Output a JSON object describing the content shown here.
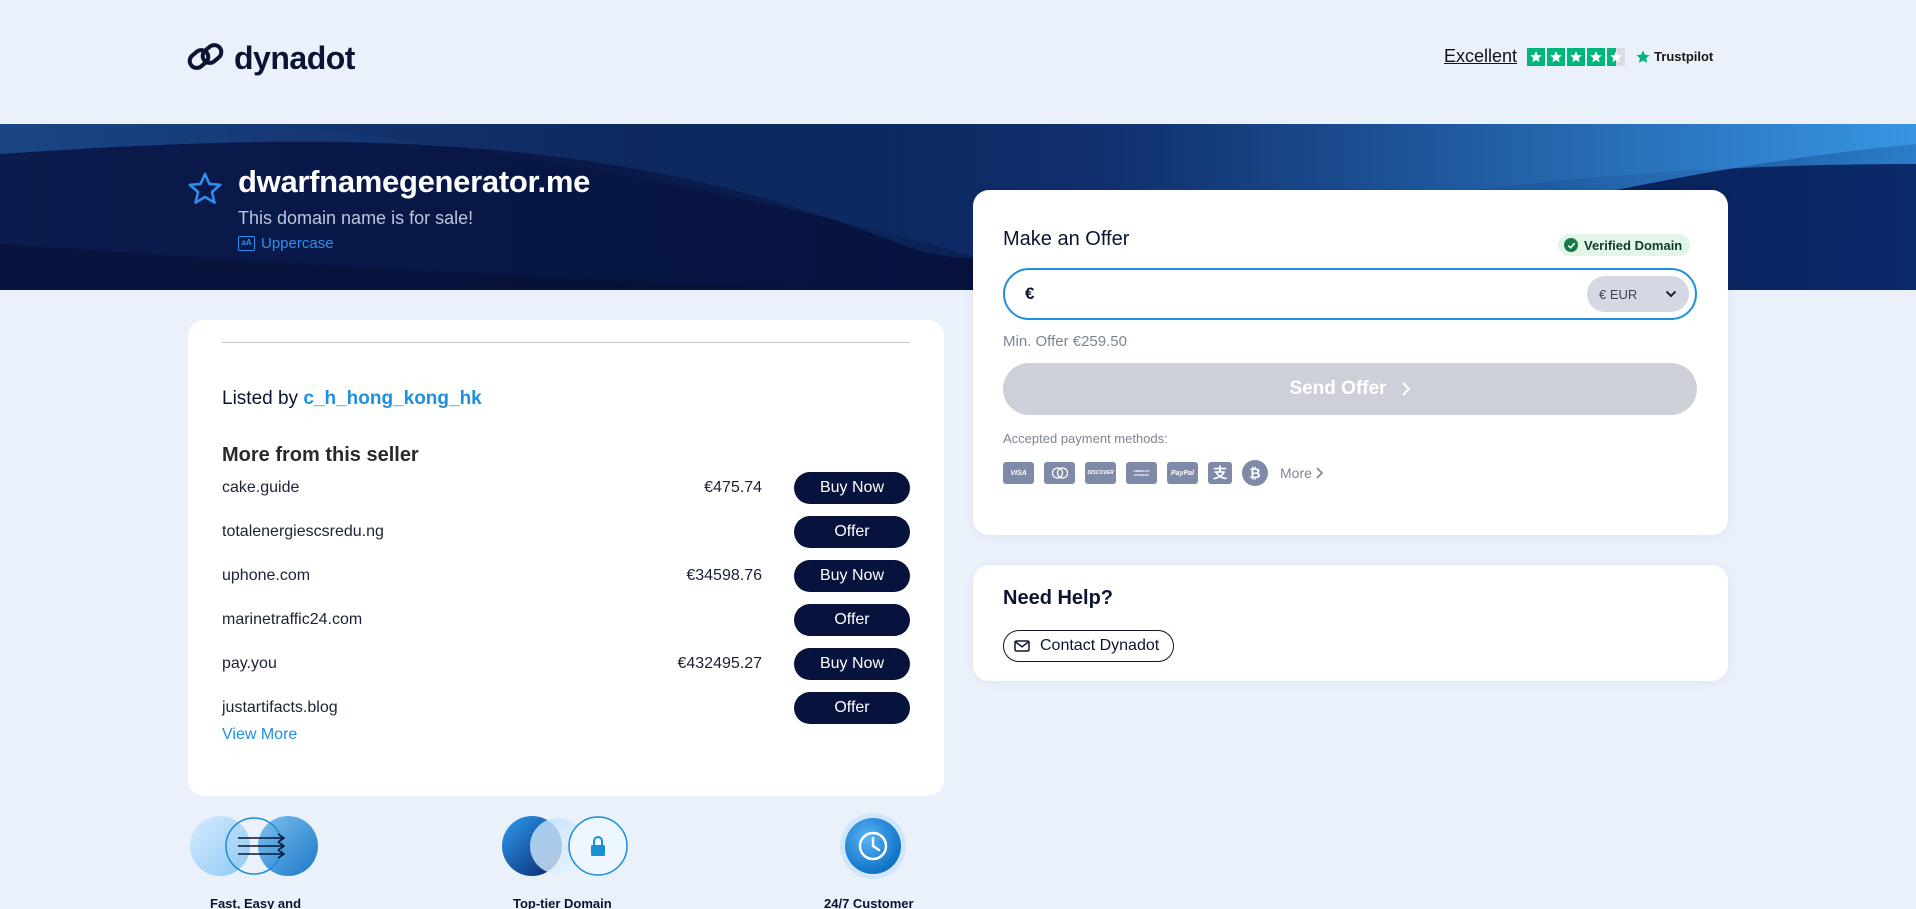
{
  "brand": {
    "name": "dynadot"
  },
  "trustpilot": {
    "rating_label": "Excellent",
    "brand": "Trustpilot",
    "stars": 4.5
  },
  "domain": {
    "name": "dwarfnamegenerator.me",
    "subtitle": "This domain name is for sale!",
    "uppercase_label": "Uppercase"
  },
  "seller": {
    "listed_prefix": "Listed by ",
    "username": "c_h_hong_kong_hk",
    "more_heading": "More from this seller",
    "items": [
      {
        "domain": "cake.guide",
        "price": "€475.74",
        "action": "Buy Now"
      },
      {
        "domain": "totalenergiescsredu.ng",
        "price": "",
        "action": "Offer"
      },
      {
        "domain": "uphone.com",
        "price": "€34598.76",
        "action": "Buy Now"
      },
      {
        "domain": "marinetraffic24.com",
        "price": "",
        "action": "Offer"
      },
      {
        "domain": "pay.you",
        "price": "€432495.27",
        "action": "Buy Now"
      },
      {
        "domain": "justartifacts.blog",
        "price": "",
        "action": "Offer"
      }
    ],
    "view_more": "View More"
  },
  "features": [
    {
      "label": "Fast, Easy and",
      "icon": "transfer-arrows-icon"
    },
    {
      "label": "Top-tier Domain",
      "icon": "lock-icon"
    },
    {
      "label": "24/7 Customer",
      "icon": "clock-icon"
    }
  ],
  "offer": {
    "title": "Make an Offer",
    "verified_label": "Verified Domain",
    "currency_symbol": "€",
    "amount_value": "",
    "currency_select": "€ EUR",
    "min_offer": "Min. Offer €259.50",
    "send_label": "Send Offer",
    "payments_label": "Accepted payment methods:",
    "payment_methods": [
      "VISA",
      "Mastercard",
      "DISCOVER",
      "AMERICAN EXPRESS",
      "PayPal",
      "Alipay",
      "Bitcoin"
    ],
    "more_label": "More"
  },
  "help": {
    "title": "Need Help?",
    "contact_label": "Contact Dynadot"
  },
  "colors": {
    "navy": "#07123d",
    "accent_blue": "#1f8fe0",
    "page_bg": "#eaf1fb",
    "trustpilot_green": "#00b67a",
    "disabled_button": "#cdd0d9"
  }
}
